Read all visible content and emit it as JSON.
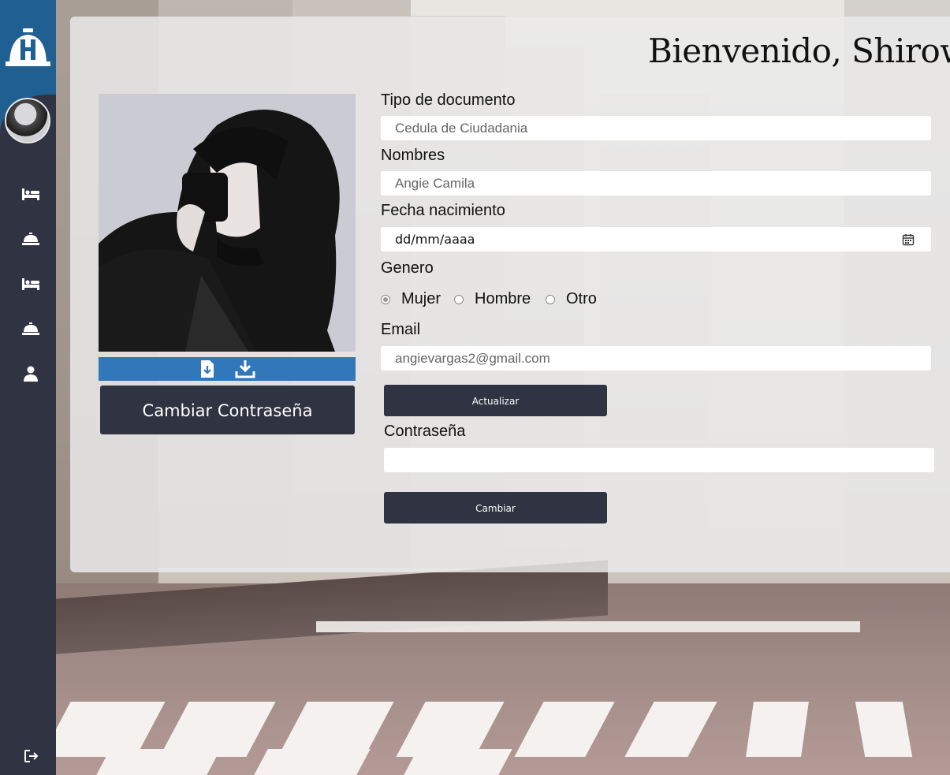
{
  "sidebar": {
    "logo_icon": "hotel-bell-h-logo",
    "nav_icons": [
      "bed-icon",
      "service-bell-icon",
      "bed-icon",
      "service-bell-icon",
      "user-icon"
    ],
    "logout_icon": "logout-icon",
    "colors": {
      "sidebar_bg": "#2f3342",
      "header_bg": "#1f5f92"
    }
  },
  "header": {
    "welcome": "Bienvenido, Shirow"
  },
  "profile": {
    "photo_bar_icons": [
      "file-download-icon",
      "download-icon"
    ],
    "change_password_label": "Cambiar Contraseña",
    "accent_color": "#3377bb"
  },
  "form": {
    "doc_type": {
      "label": "Tipo de documento",
      "value": "Cedula de Ciudadania"
    },
    "names": {
      "label": "Nombres",
      "value": "Angie Camila"
    },
    "birth": {
      "label": "Fecha nacimiento",
      "value": "dd/mm/aaaa"
    },
    "gender": {
      "label": "Genero",
      "options": [
        "Mujer",
        "Hombre",
        "Otro"
      ],
      "selected": "Mujer"
    },
    "email": {
      "label": "Email",
      "value": "angievargas2@gmail.com"
    },
    "update_label": "Actualizar",
    "password": {
      "label": "Contraseña",
      "value": ""
    },
    "change_label": "Cambiar"
  }
}
